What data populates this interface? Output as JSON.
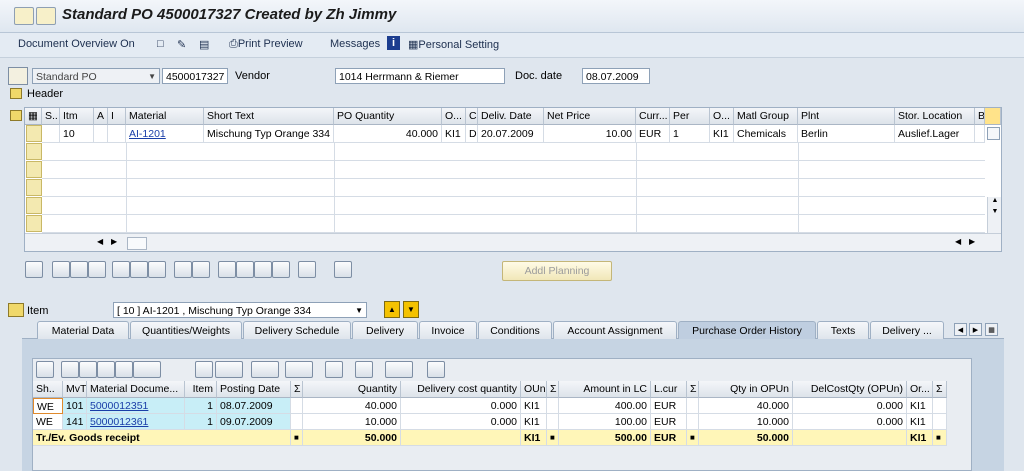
{
  "window": {
    "title": "Standard PO 4500017327 Created by Zh Jimmy"
  },
  "toolbar": {
    "document_overview": "Document Overview On",
    "print_preview": "Print Preview",
    "messages": "Messages",
    "personal_setting": "Personal Setting"
  },
  "header": {
    "po_type": "Standard PO",
    "po_number": "4500017327",
    "vendor_label": "Vendor",
    "vendor_value": "1014 Herrmann & Riemer",
    "doc_date_label": "Doc. date",
    "doc_date_value": "08.07.2009",
    "header_label": "Header"
  },
  "items_table": {
    "columns": [
      "S..",
      "Itm",
      "A",
      "I",
      "Material",
      "Short Text",
      "PO Quantity",
      "O...",
      "C",
      "Deliv. Date",
      "Net Price",
      "Curr...",
      "Per",
      "O...",
      "Matl Group",
      "Plnt",
      "Stor. Location",
      "B"
    ],
    "rows": [
      {
        "itm": "10",
        "a": "",
        "i": "",
        "material": "AI-1201",
        "short_text": "Mischung Typ Orange 334",
        "po_qty": "40.000",
        "oun": "KI1",
        "c": "D",
        "deliv_date": "20.07.2009",
        "net_price": "10.00",
        "curr": "EUR",
        "per": "1",
        "opu": "KI1",
        "matl_group": "Chemicals",
        "plnt": "Berlin",
        "sloc": "Auslief.Lager"
      }
    ],
    "addl_planning": "Addl Planning"
  },
  "item_detail": {
    "item_label": "Item",
    "item_value": "[ 10 ] AI-1201 , Mischung Typ Orange 334",
    "tabs": [
      "Material Data",
      "Quantities/Weights",
      "Delivery Schedule",
      "Delivery",
      "Invoice",
      "Conditions",
      "Account Assignment",
      "Purchase Order History",
      "Texts",
      "Delivery ..."
    ],
    "active_tab": "Purchase Order History"
  },
  "history_table": {
    "columns": [
      "Sh..",
      "MvT",
      "Material Docume...",
      "Item",
      "Posting Date",
      "Σ",
      "Quantity",
      "Delivery cost quantity",
      "OUn",
      "Σ",
      "Amount in LC",
      "L.cur",
      "Σ",
      "Qty in OPUn",
      "DelCostQty (OPUn)",
      "Or...",
      "Σ"
    ],
    "rows": [
      {
        "sh": "WE",
        "mvt": "101",
        "doc": "5000012351",
        "item": "1",
        "date": "08.07.2009",
        "qty": "40.000",
        "dcq": "0.000",
        "oun": "KI1",
        "amount": "400.00",
        "lcur": "EUR",
        "qty_opun": "40.000",
        "dcq_opun": "0.000",
        "or": "KI1"
      },
      {
        "sh": "WE",
        "mvt": "141",
        "doc": "5000012361",
        "item": "1",
        "date": "09.07.2009",
        "qty": "10.000",
        "dcq": "0.000",
        "oun": "KI1",
        "amount": "100.00",
        "lcur": "EUR",
        "qty_opun": "10.000",
        "dcq_opun": "0.000",
        "or": "KI1"
      }
    ],
    "total": {
      "label": "Tr./Ev. Goods receipt",
      "qty": "50.000",
      "oun": "KI1",
      "amount": "500.00",
      "lcur": "EUR",
      "qty_opun": "50.000",
      "or": "KI1"
    }
  },
  "colors": {
    "selected_tab": "#bfcee0",
    "row_highlight": "#c8eef7",
    "total_row": "#fff6b8"
  }
}
